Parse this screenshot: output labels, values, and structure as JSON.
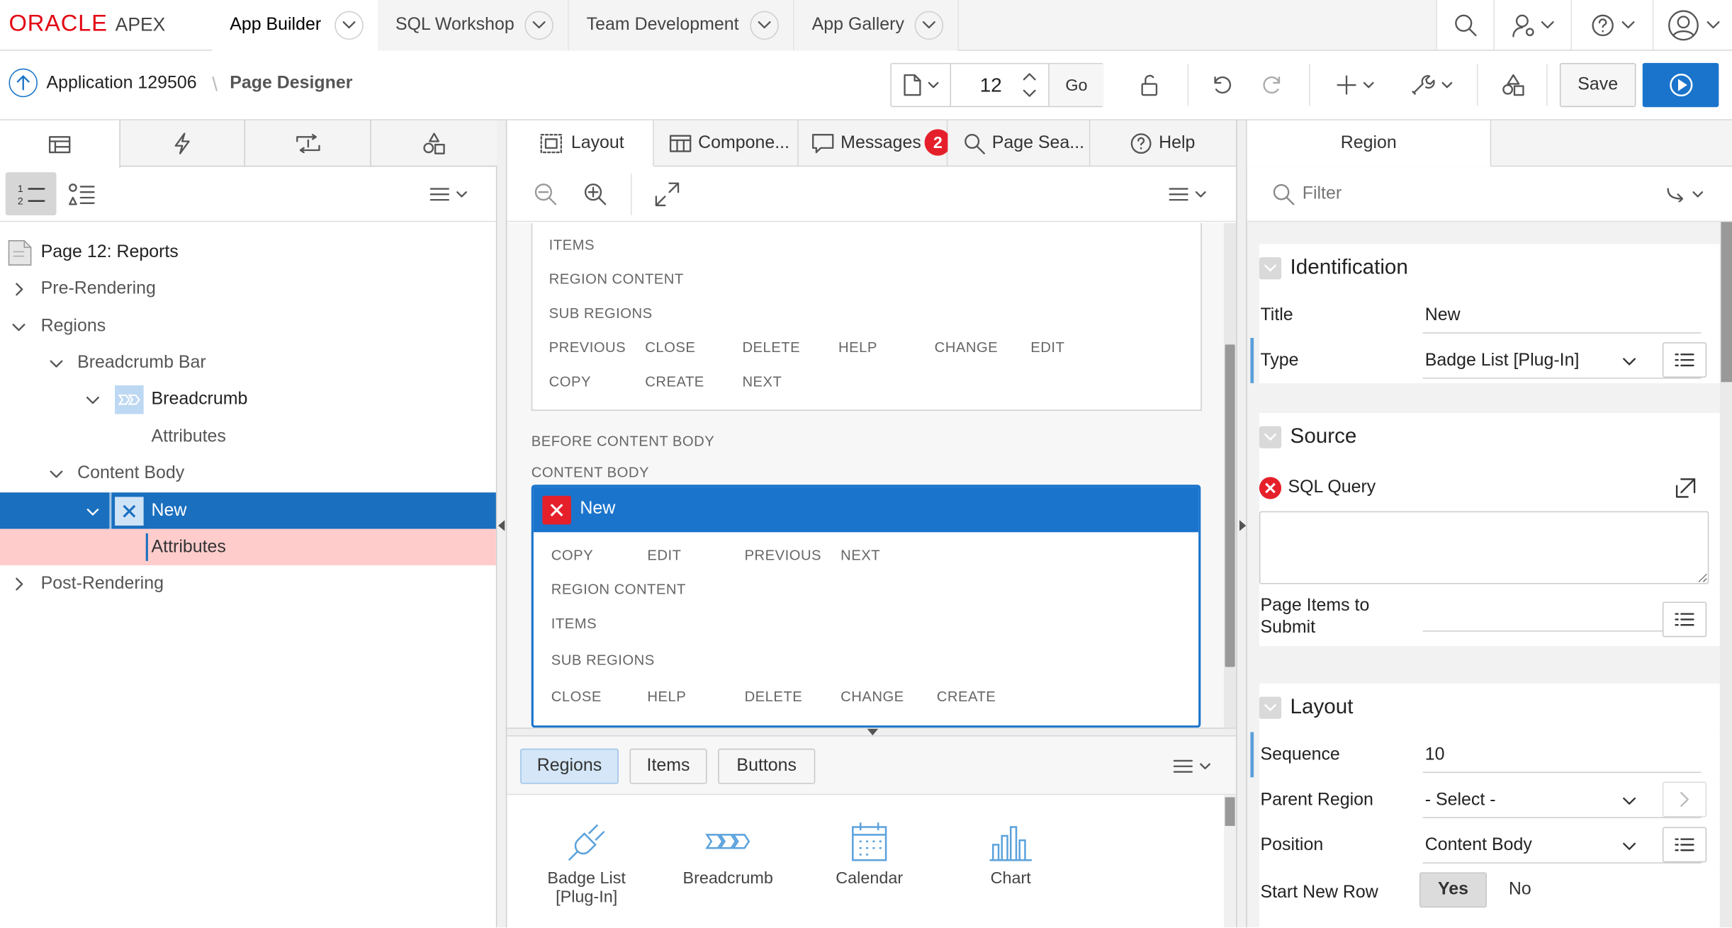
{
  "top_nav": {
    "logo_oracle": "ORACLE",
    "logo_apex": "APEX",
    "tabs": [
      {
        "label": "App Builder"
      },
      {
        "label": "SQL Workshop"
      },
      {
        "label": "Team Development"
      },
      {
        "label": "App Gallery"
      }
    ]
  },
  "page_designer_bar": {
    "app_label": "Application 129506",
    "separator": "\\",
    "page_designer_label": "Page Designer",
    "page_number": "12",
    "go_label": "Go",
    "save_label": "Save"
  },
  "left_panel": {
    "tree": {
      "page": "Page 12: Reports",
      "pre_rendering": "Pre-Rendering",
      "regions": "Regions",
      "breadcrumb_bar": "Breadcrumb Bar",
      "breadcrumb": "Breadcrumb",
      "attributes_1": "Attributes",
      "content_body": "Content Body",
      "new_region": "New",
      "attributes_2": "Attributes",
      "post_rendering": "Post-Rendering"
    }
  },
  "middle_panel": {
    "tabs": [
      {
        "label": "Layout"
      },
      {
        "label": "Compone..."
      },
      {
        "label": "Messages",
        "badge": "2"
      },
      {
        "label": "Page Sea..."
      },
      {
        "label": "Help"
      }
    ],
    "upper_region": {
      "items": "ITEMS",
      "region_content": "REGION CONTENT",
      "sub_regions": "SUB REGIONS",
      "row1": [
        "PREVIOUS",
        "CLOSE",
        "DELETE",
        "HELP",
        "CHANGE",
        "EDIT"
      ],
      "row2": [
        "COPY",
        "CREATE",
        "NEXT"
      ]
    },
    "before_content_body": "BEFORE CONTENT BODY",
    "content_body": "CONTENT BODY",
    "new_region": {
      "title": "New",
      "row1": [
        "COPY",
        "EDIT",
        "PREVIOUS",
        "NEXT"
      ],
      "region_content": "REGION CONTENT",
      "items": "ITEMS",
      "sub_regions": "SUB REGIONS",
      "row2": [
        "CLOSE",
        "HELP",
        "DELETE",
        "CHANGE",
        "CREATE"
      ]
    },
    "gallery": {
      "buttons": [
        {
          "label": "Regions"
        },
        {
          "label": "Items"
        },
        {
          "label": "Buttons"
        }
      ],
      "items": [
        {
          "label_line1": "Badge List",
          "label_line2": "[Plug-In]"
        },
        {
          "label_line1": "Breadcrumb",
          "label_line2": ""
        },
        {
          "label_line1": "Calendar",
          "label_line2": ""
        },
        {
          "label_line1": "Chart",
          "label_line2": ""
        }
      ]
    }
  },
  "right_panel": {
    "tab_label": "Region",
    "filter_placeholder": "Filter",
    "sections": {
      "identification": "Identification",
      "source": "Source",
      "layout": "Layout"
    },
    "props": {
      "title_label": "Title",
      "title_value": "New",
      "type_label": "Type",
      "type_value": "Badge List [Plug-In]",
      "sql_query_label": "SQL Query",
      "page_items_label_1": "Page Items to",
      "page_items_label_2": "Submit",
      "sequence_label": "Sequence",
      "sequence_value": "10",
      "parent_region_label": "Parent Region",
      "parent_region_value": "- Select -",
      "position_label": "Position",
      "position_value": "Content Body",
      "start_new_row_label": "Start New Row",
      "yes_label": "Yes",
      "no_label": "No"
    }
  },
  "colors": {
    "oracle_red": "#e30613",
    "selection_blue": "#1a6fbf",
    "region_header_blue": "#1a74cc",
    "error_red": "#e5202a",
    "attributes_pink": "#ffcccc"
  }
}
